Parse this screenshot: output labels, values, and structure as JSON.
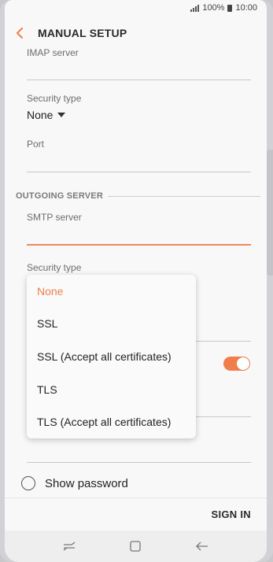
{
  "status_bar": {
    "battery": "100%",
    "time": "10:00"
  },
  "app_bar": {
    "title": "MANUAL SETUP"
  },
  "incoming": {
    "imap_label": "IMAP server",
    "imap_value": "",
    "security_label": "Security type",
    "security_value": "None",
    "port_label": "Port",
    "port_value": ""
  },
  "outgoing": {
    "section_title": "OUTGOING SERVER",
    "smtp_label": "SMTP server",
    "smtp_value": "",
    "security_label": "Security type",
    "auth_toggle_on": true
  },
  "security_dropdown": {
    "selected": "None",
    "options": [
      "None",
      "SSL",
      "SSL (Accept all certificates)",
      "TLS",
      "TLS (Accept all certificates)"
    ]
  },
  "show_password": {
    "label": "Show password",
    "checked": false
  },
  "actions": {
    "sign_in": "SIGN IN"
  },
  "colors": {
    "accent": "#f07e4c",
    "text": "#222222",
    "label": "#6d6d6d"
  },
  "icons": [
    "back-icon",
    "caret-down-icon",
    "recent-apps-icon",
    "home-icon",
    "nav-back-icon"
  ]
}
